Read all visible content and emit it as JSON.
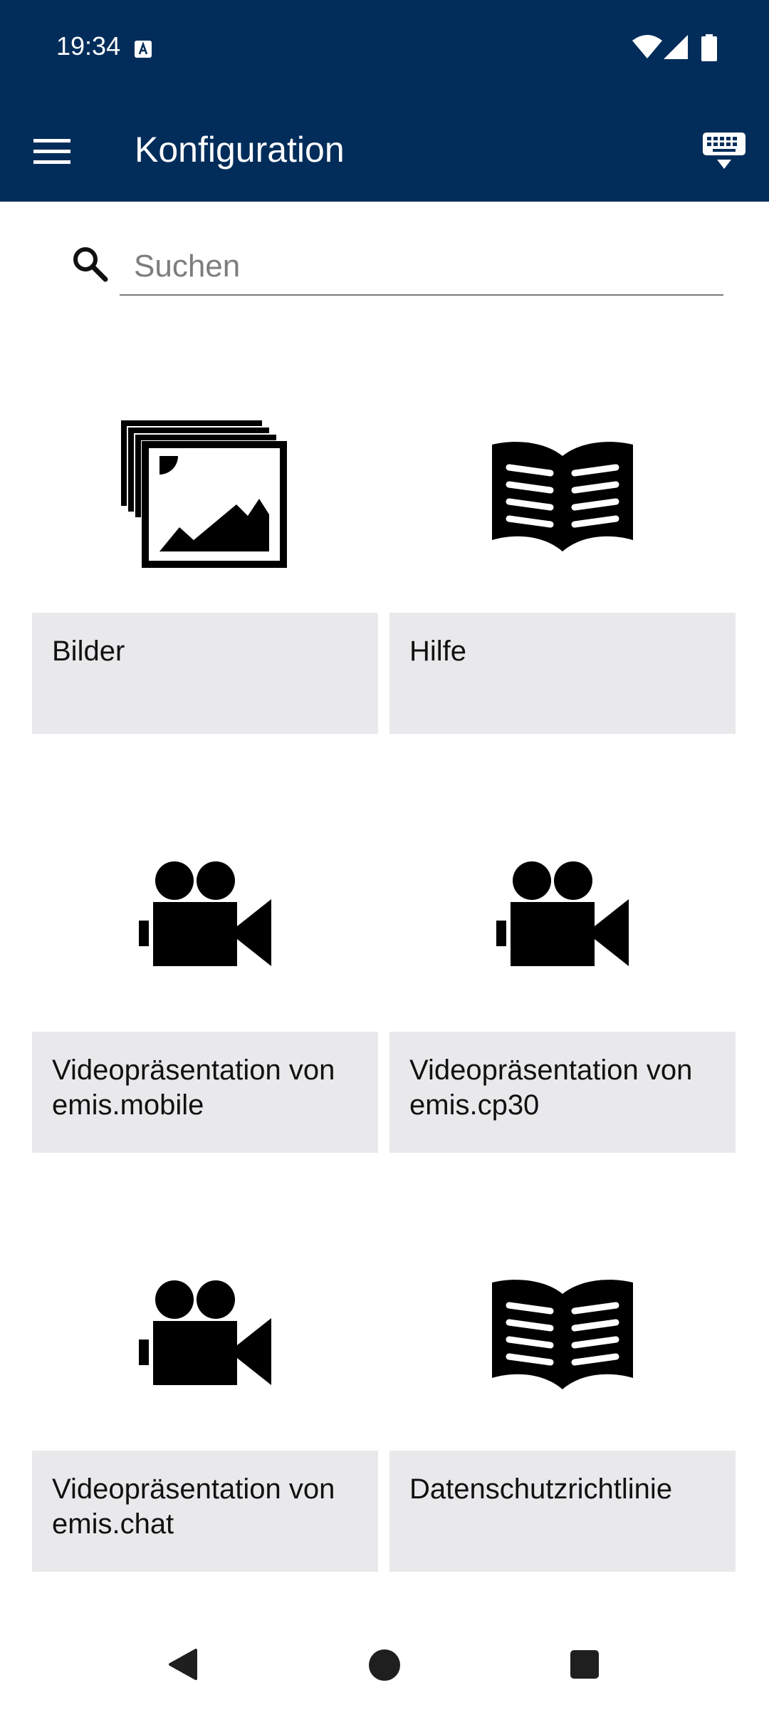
{
  "status_bar": {
    "time": "19:34"
  },
  "header": {
    "title": "Konfiguration",
    "background_color": "#022d5a"
  },
  "search": {
    "placeholder": "Suchen",
    "value": ""
  },
  "tiles": [
    {
      "label": "Bilder",
      "icon": "images-icon"
    },
    {
      "label": "Hilfe",
      "icon": "book-icon"
    },
    {
      "label": "Videopräsentation von emis.mobile",
      "icon": "movie-camera-icon"
    },
    {
      "label": "Videopräsentation von emis.cp30",
      "icon": "movie-camera-icon"
    },
    {
      "label": "Videopräsentation von emis.chat",
      "icon": "movie-camera-icon"
    },
    {
      "label": "Datenschutzrichtlinie",
      "icon": "book-icon"
    }
  ],
  "colors": {
    "accent": "#022d5a",
    "tile_label_background": "#e9e9eb"
  }
}
